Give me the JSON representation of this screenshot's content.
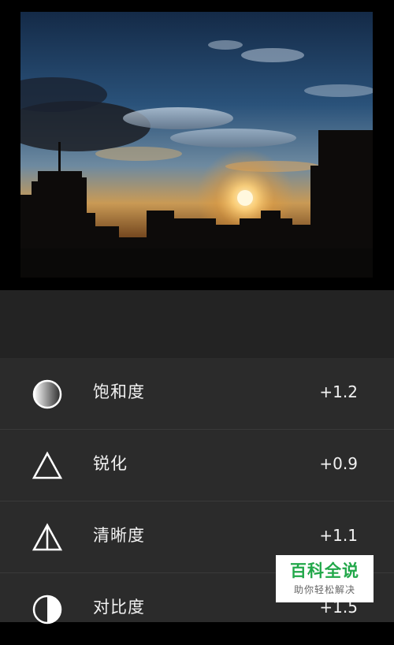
{
  "photo": {
    "scene": "sunset-city-skyline"
  },
  "panel": {
    "collapse_icon": "chevron-down-icon",
    "adjustments": [
      {
        "label": "饱和度",
        "value": "+1.2",
        "icon": "saturation-icon"
      },
      {
        "label": "锐化",
        "value": "+0.9",
        "icon": "sharpen-icon"
      },
      {
        "label": "清晰度",
        "value": "+1.1",
        "icon": "clarity-icon"
      },
      {
        "label": "对比度",
        "value": "+1.5",
        "icon": "contrast-icon"
      }
    ]
  },
  "watermark": {
    "brand": "百科全说",
    "slogan": "助你轻松解决"
  },
  "colors": {
    "panel_background": "#2b2b2b",
    "collapse_bar_background": "#232323",
    "text": "#f2f2f2",
    "watermark_brand": "#22a84a"
  }
}
